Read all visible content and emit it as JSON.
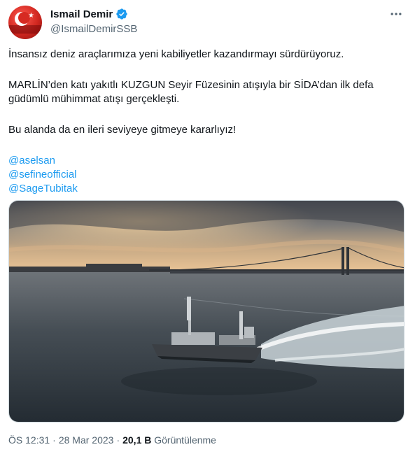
{
  "author": {
    "name": "Ismail Demir",
    "handle": "@IsmailDemirSSB"
  },
  "icons": {
    "verified": "verified-badge-icon",
    "more": "more-horizontal-icon"
  },
  "tweet": {
    "paragraphs": [
      "İnsansız deniz araçlarımıza yeni kabiliyetler kazandırmayı sürdürüyoruz.",
      "MARLİN’den katı yakıtlı KUZGUN Seyir Füzesinin atışıyla bir SİDA’dan ilk defa güdümlü mühimmat atışı gerçekleşti.",
      "Bu alanda da en ileri seviyeye gitmeye kararlıyız!"
    ],
    "mentions": [
      "@aselsan",
      "@sefineofficial",
      "@SageTubitak"
    ]
  },
  "meta": {
    "time": "ÖS 12:31",
    "date": "28 Mar 2023",
    "views_count": "20,1 B",
    "views_label": "Görüntülenme"
  },
  "colors": {
    "accent": "#1d9bf0",
    "text": "#0f1419",
    "secondary": "#536471"
  }
}
